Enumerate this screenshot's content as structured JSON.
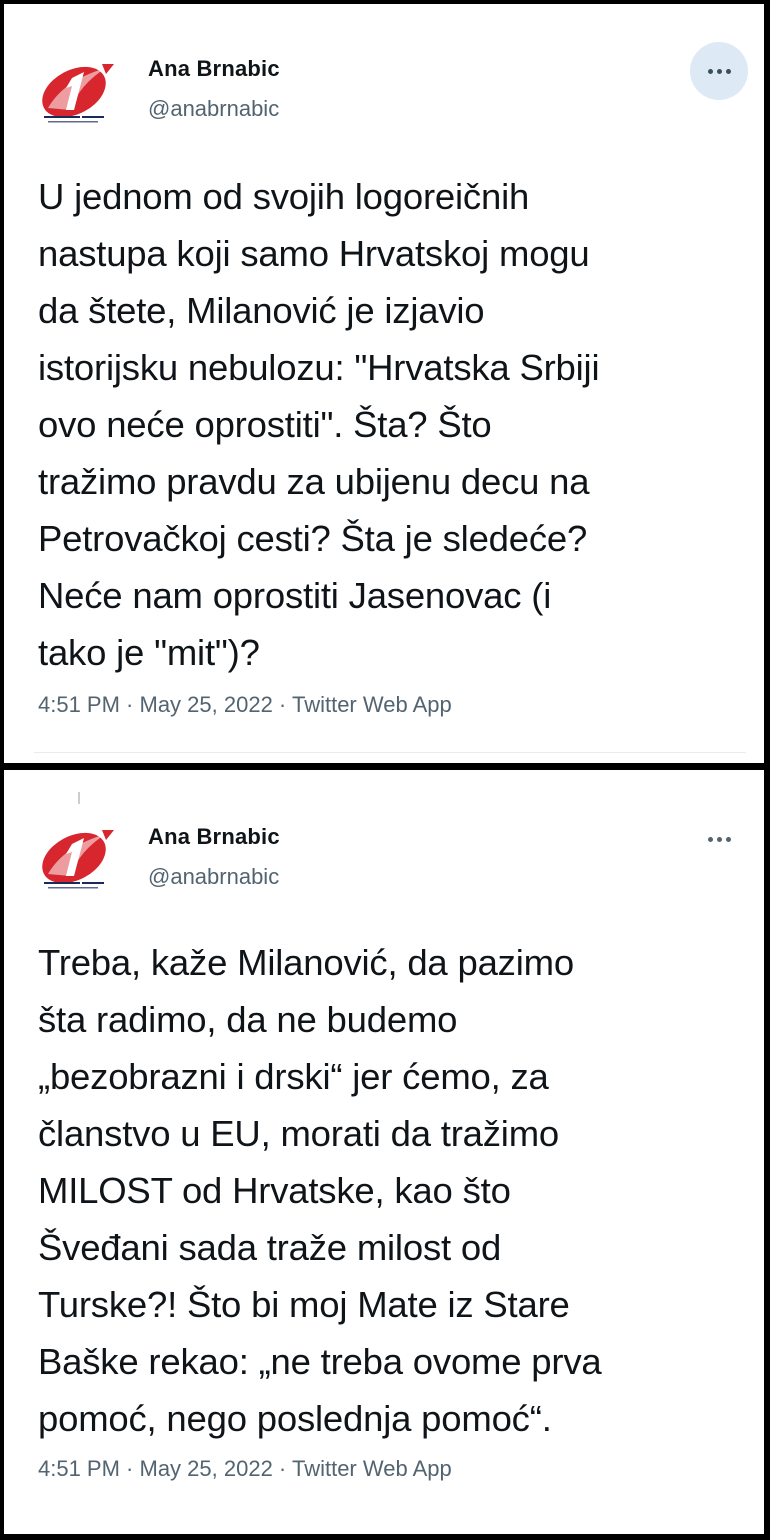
{
  "tweets": [
    {
      "author": {
        "name": "Ana Brnabic",
        "handle": "@anabrnabic",
        "avatar_icon": "party-logo-icon"
      },
      "more_icon": "more-dots-icon",
      "text": "U jednom od svojih logoreičnih\nnastupa koji samo Hrvatskoj mogu\nda štete, Milanović je izjavio\nistorijsku nebulozu: \"Hrvatska Srbiji\novo neće oprostiti\". Šta? Što\ntražimo pravdu za ubijenu decu na\nPetrovačkoj cesti? Šta je sledeće?\nNeće nam oprostiti Jasenovac (i\ntako je \"mit\")?",
      "time": "4:51 PM",
      "date": "May 25, 2022",
      "source": "Twitter Web App"
    },
    {
      "author": {
        "name": "Ana Brnabic",
        "handle": "@anabrnabic",
        "avatar_icon": "party-logo-icon"
      },
      "more_icon": "more-dots-icon",
      "text": "Treba, kaže Milanović, da pazimo\nšta radimo, da ne budemo\n„bezobrazni i drski“ jer ćemo, za\nčlanstvo u EU, morati da tražimo\nMILOST od Hrvatske, kao što\nŠveđani sada traže milost od\nTurske?! Što bi moj Mate iz Stare\nBaške rekao: „ne treba ovome prva\npomoć, nego poslednja pomoć“.",
      "time": "4:51 PM",
      "date": "May 25, 2022",
      "source": "Twitter Web App"
    }
  ],
  "meta_separator": " · ",
  "colors": {
    "text_primary": "#0f1419",
    "text_secondary": "#536471",
    "logo_red": "#d7262e",
    "logo_navy": "#1b2a5c",
    "hover_bg": "#dde9f5"
  }
}
